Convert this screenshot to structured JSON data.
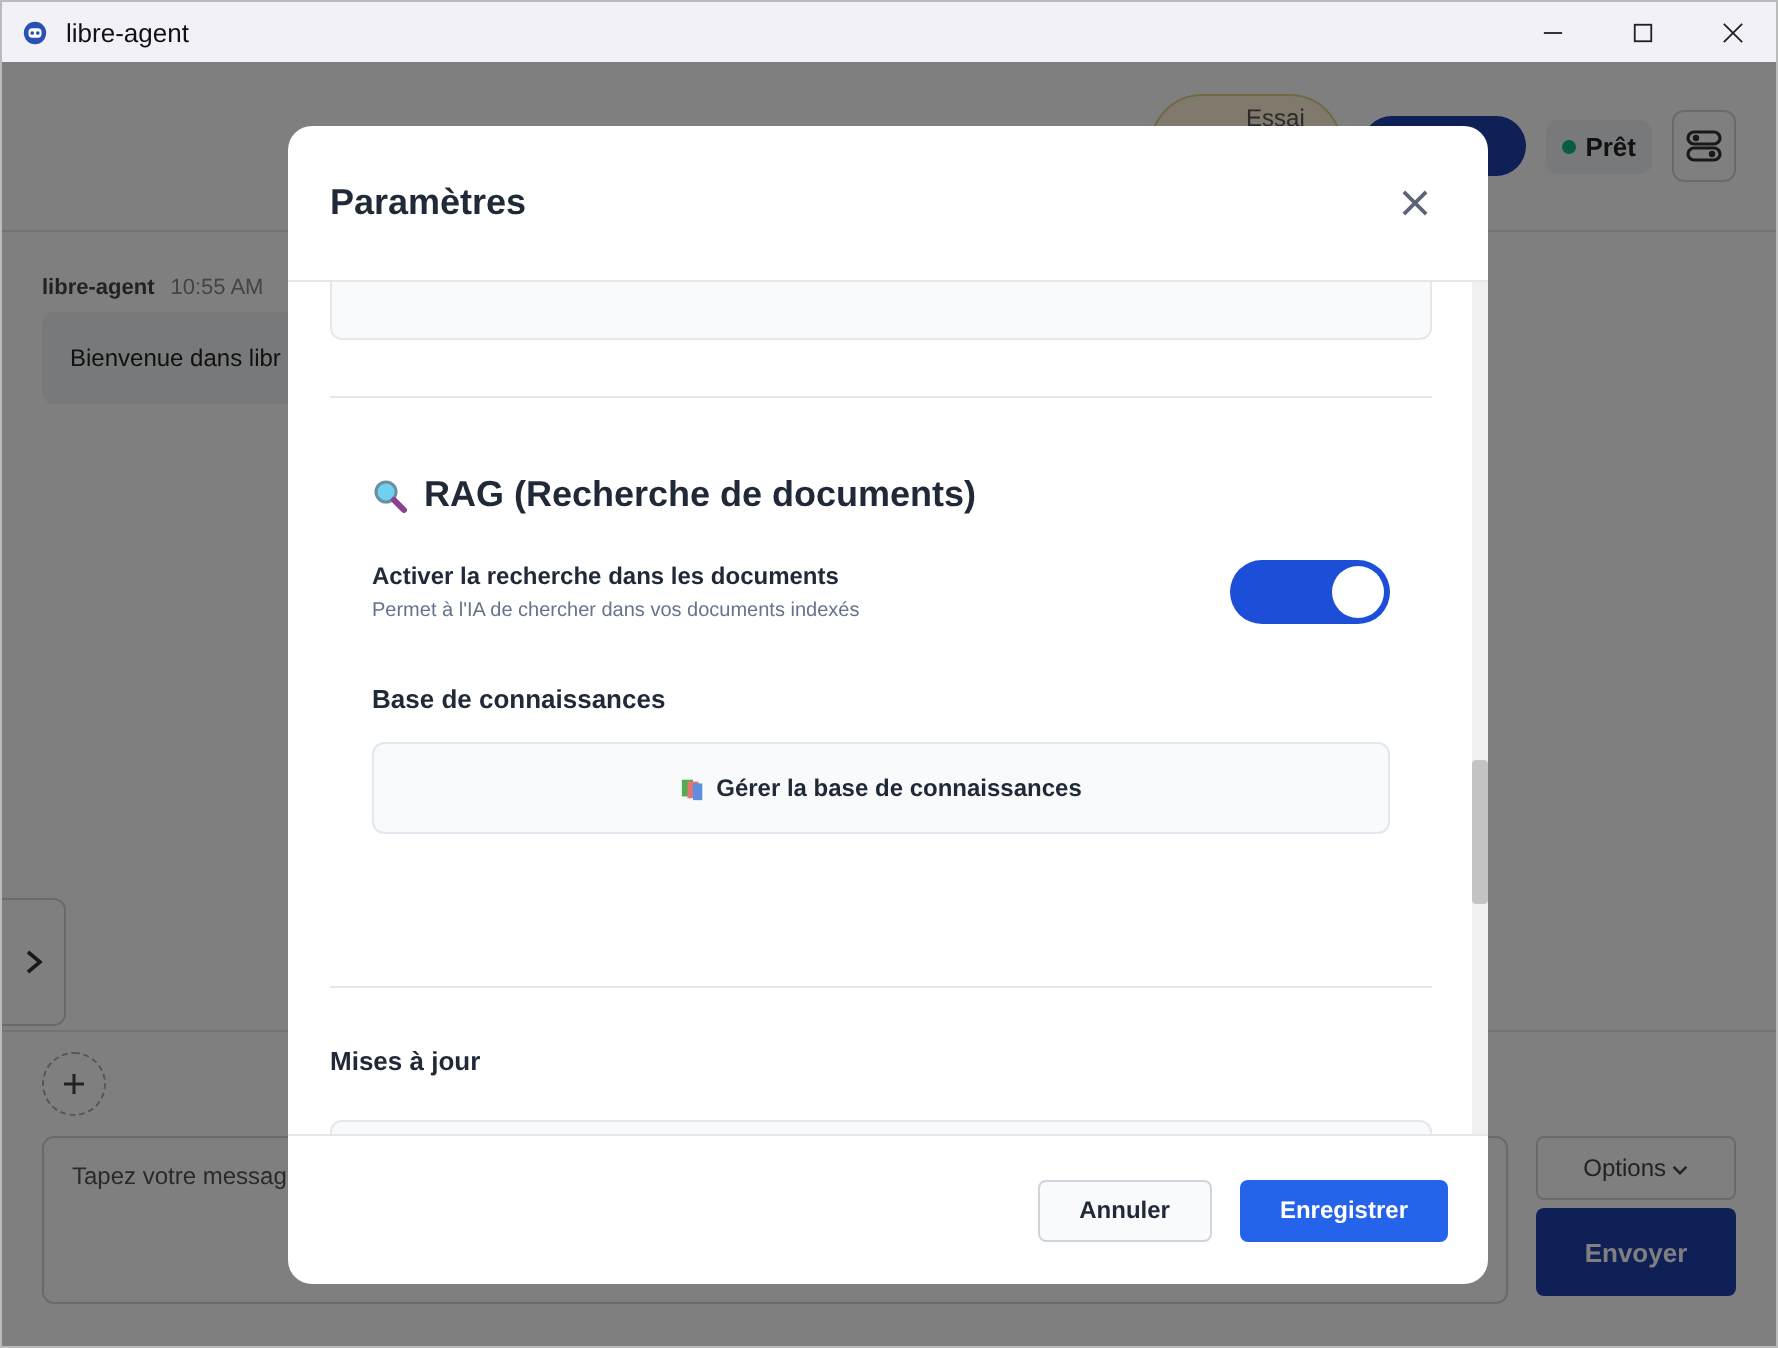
{
  "window": {
    "title": "libre-agent"
  },
  "header": {
    "trial_button": "Essai",
    "status": "Prêt"
  },
  "messages": [
    {
      "author": "libre-agent",
      "time": "10:55 AM",
      "text": "Bienvenue dans libr"
    }
  ],
  "composer": {
    "placeholder": "Tapez votre messag",
    "options": "Options",
    "send": "Envoyer"
  },
  "dialog": {
    "title": "Paramètres",
    "rag": {
      "title": "RAG (Recherche de documents)",
      "toggle_label": "Activer la recherche dans les documents",
      "toggle_hint": "Permet à l'IA de chercher dans vos documents indexés",
      "on": true,
      "kb_title": "Base de connaissances",
      "kb_button": "Gérer la base de connaissances"
    },
    "updates": {
      "title": "Mises à jour"
    },
    "buttons": {
      "cancel": "Annuler",
      "save": "Enregistrer"
    }
  }
}
